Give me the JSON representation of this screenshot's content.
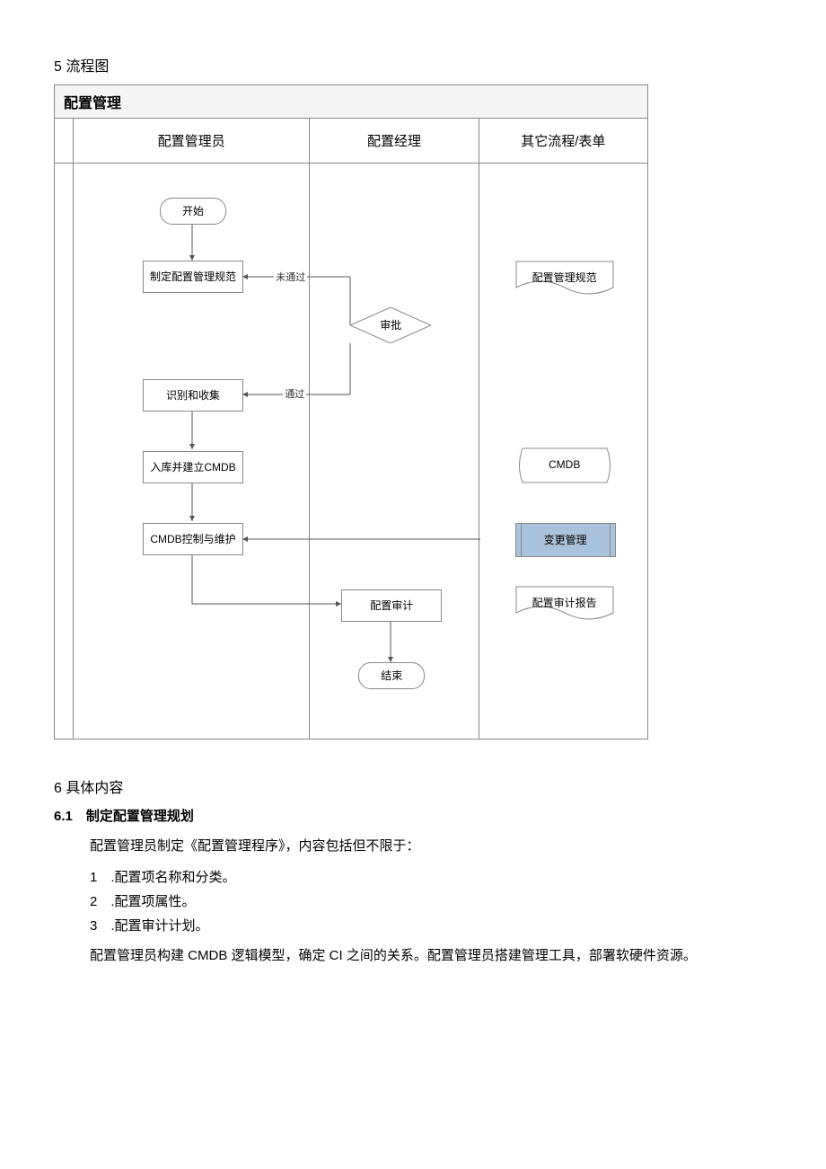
{
  "sections": {
    "s5_title": "5 流程图",
    "s6_title": "6 具体内容",
    "s61_title": "6.1　制定配置管理规划",
    "s61_p1": "配置管理员制定《配置管理程序》，内容包括但不限于：",
    "s61_li1": "1　.配置项名称和分类。",
    "s61_li2": "2　.配置项属性。",
    "s61_li3": "3　.配置审计计划。",
    "s61_p2": "配置管理员构建 CMDB 逻辑模型，确定 CI 之间的关系。配置管理员搭建管理工具，部署软硬件资源。"
  },
  "diagram": {
    "title": "配置管理",
    "lanes": {
      "lane1": "配置管理员",
      "lane2": "配置经理",
      "lane3": "其它流程/表单"
    },
    "nodes": {
      "start": "开始",
      "n1": "制定配置管理规范",
      "n2": "识别和收集",
      "n3": "入库并建立CMDB",
      "n4": "CMDB控制与维护",
      "approve": "审批",
      "audit": "配置审计",
      "end": "结束",
      "doc1": "配置管理规范",
      "cmdb": "CMDB",
      "change": "变更管理",
      "doc2": "配置审计报告"
    },
    "edges": {
      "fail": "未通过",
      "pass": "通过"
    }
  }
}
